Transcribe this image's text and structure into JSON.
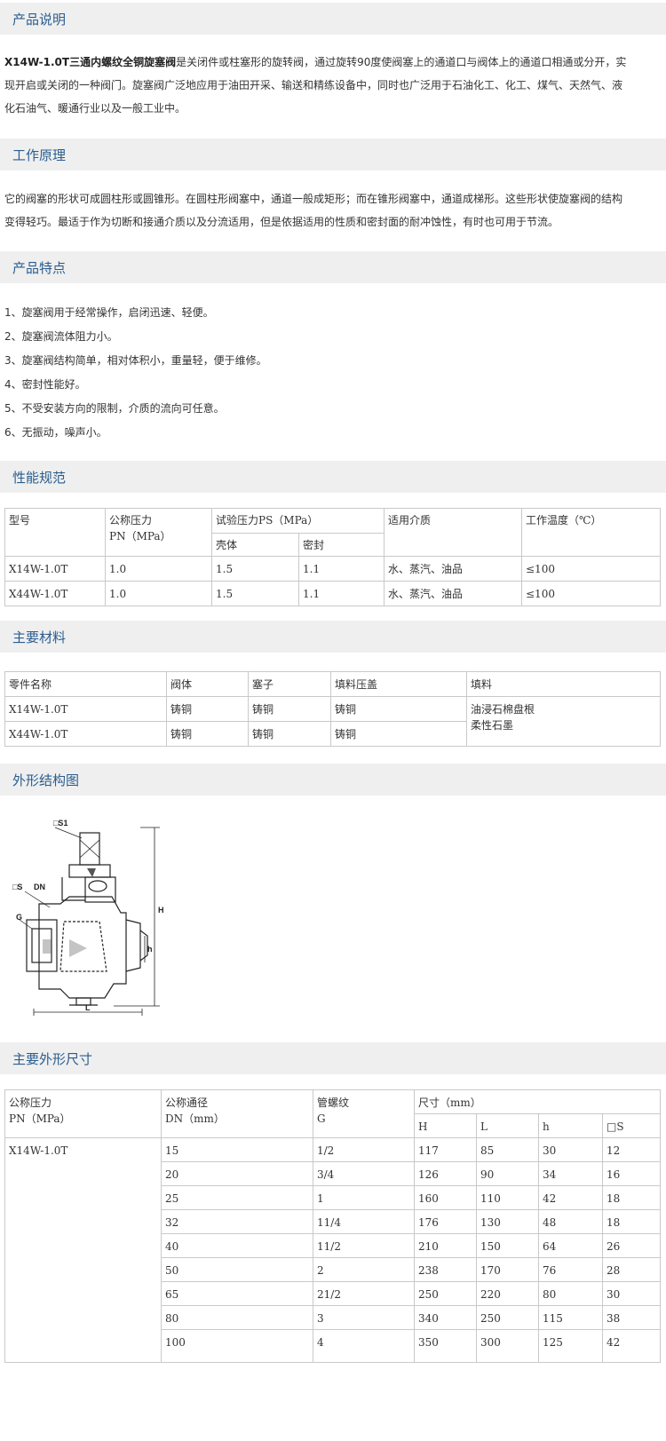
{
  "sections": {
    "intro": "产品说明",
    "principle": "工作原理",
    "features": "产品特点",
    "specs": "性能规范",
    "materials": "主要材料",
    "structure": "外形结构图",
    "dimensions": "主要外形尺寸"
  },
  "intro": {
    "bold": "X14W-1.0T三通内螺纹全铜旋塞阀",
    "line1_rest": "是关闭件或柱塞形的旋转阀，通过旋转90度使阀塞上的通道口与阀体上的通道口相通或分开，实",
    "line2": "现开启或关闭的一种阀门。旋塞阀广泛地应用于油田开采、输送和精练设备中，同时也广泛用于石油化工、化工、煤气、天然气、液",
    "line3": "化石油气、暖通行业以及一般工业中。"
  },
  "principle": {
    "line1": "它的阀塞的形状可成圆柱形或圆锥形。在圆柱形阀塞中，通道一般成矩形；而在锥形阀塞中，通道成梯形。这些形状使旋塞阀的结构",
    "line2": "变得轻巧。最适于作为切断和接通介质以及分流适用，但是依据适用的性质和密封面的耐冲蚀性，有时也可用于节流。"
  },
  "features": [
    "1、旋塞阀用于经常操作，启闭迅速、轻便。",
    "2、旋塞阀流体阻力小。",
    "3、旋塞阀结构简单，相对体积小，重量轻，便于维修。",
    "4、密封性能好。",
    "5、不受安装方向的限制，介质的流向可任意。",
    "6、无振动，噪声小。"
  ],
  "specs": {
    "h_model": "型号",
    "h_pn": "公称压力",
    "h_pn_unit": "PN（MPa）",
    "h_test": "试验压力PS（MPa）",
    "h_shell": "壳体",
    "h_seal": "密封",
    "h_media": "适用介质",
    "h_temp": "工作温度（℃）",
    "rows": [
      {
        "model": "X14W-1.0T",
        "pn": "1.0",
        "shell": "1.5",
        "seal": "1.1",
        "media": "水、蒸汽、油品",
        "temp": "≤100"
      },
      {
        "model": "X44W-1.0T",
        "pn": "1.0",
        "shell": "1.5",
        "seal": "1.1",
        "media": "水、蒸汽、油品",
        "temp": "≤100"
      }
    ]
  },
  "materials": {
    "h_part": "零件名称",
    "h_body": "阀体",
    "h_plug": "塞子",
    "h_gland": "填料压盖",
    "h_pack": "填料",
    "rows": [
      {
        "model": "X14W-1.0T",
        "body": "铸铜",
        "plug": "铸铜",
        "gland": "铸铜"
      },
      {
        "model": "X44W-1.0T",
        "body": "铸铜",
        "plug": "铸铜",
        "gland": "铸铜"
      }
    ],
    "pack1": "油浸石棉盘根",
    "pack2": "柔性石墨"
  },
  "diagram": {
    "s1": "□S1",
    "s": "□S",
    "dn": "DN",
    "g": "G",
    "H": "H",
    "h": "h",
    "L": "L"
  },
  "dims": {
    "h_pn": "公称压力",
    "h_pn_unit": "PN（MPa）",
    "h_dn": "公称通径",
    "h_dn_unit": "DN（mm）",
    "h_thread": "管螺纹",
    "h_thread_g": "G",
    "h_size": "尺寸（mm）",
    "h_H": "H",
    "h_L": "L",
    "h_h": "h",
    "h_S": "□S",
    "model": "X14W-1.0T",
    "rows": [
      {
        "dn": "15",
        "g": "1/2",
        "H": "117",
        "L": "85",
        "h": "30",
        "s": "12"
      },
      {
        "dn": "20",
        "g": "3/4",
        "H": "126",
        "L": "90",
        "h": "34",
        "s": "16"
      },
      {
        "dn": "25",
        "g": "1",
        "H": "160",
        "L": "110",
        "h": "42",
        "s": "18"
      },
      {
        "dn": "32",
        "g": "11/4",
        "H": "176",
        "L": "130",
        "h": "48",
        "s": "18"
      },
      {
        "dn": "40",
        "g": "11/2",
        "H": "210",
        "L": "150",
        "h": "64",
        "s": "26"
      },
      {
        "dn": "50",
        "g": "2",
        "H": "238",
        "L": "170",
        "h": "76",
        "s": "28"
      },
      {
        "dn": "65",
        "g": "21/2",
        "H": "250",
        "L": "220",
        "h": "80",
        "s": "30"
      },
      {
        "dn": "80",
        "g": "3",
        "H": "340",
        "L": "250",
        "h": "115",
        "s": "38"
      },
      {
        "dn": "100",
        "g": "4",
        "H": "350",
        "L": "300",
        "h": "125",
        "s": "42"
      }
    ]
  }
}
